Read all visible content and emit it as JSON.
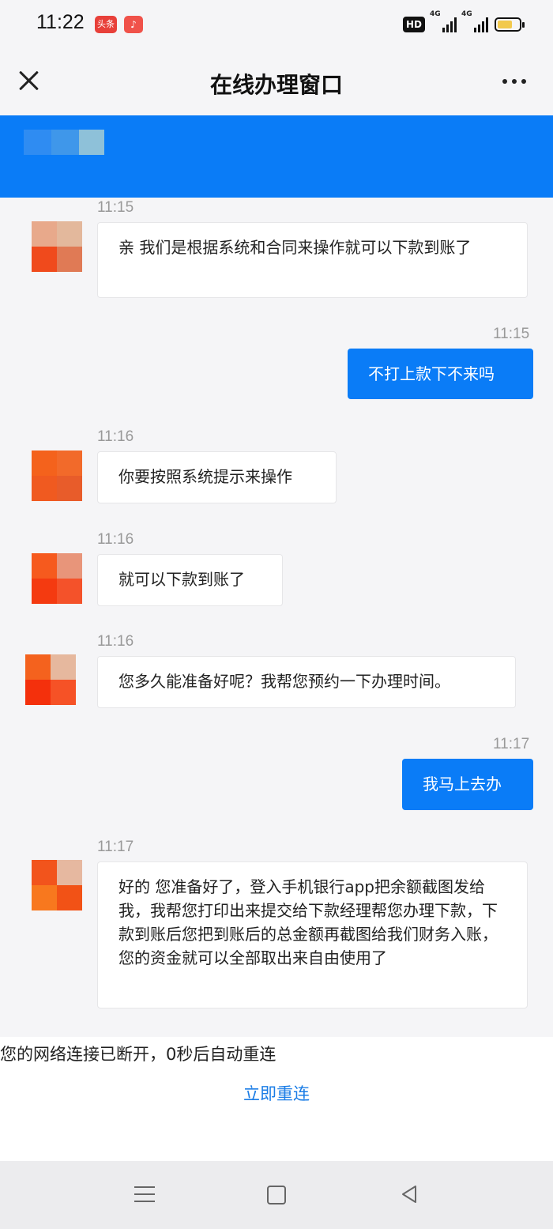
{
  "status_bar": {
    "time": "11:22",
    "app_badge_toutiao": "头条",
    "app_badge_music": "♪",
    "hd": "HD",
    "signal_1": "4G",
    "signal_2": "4G"
  },
  "nav": {
    "title": "在线办理窗口"
  },
  "messages": [
    {
      "side": "in",
      "time": "11:15",
      "text": "亲 我们是根据系统和合同来操作就可以下款到账了"
    },
    {
      "side": "out",
      "time": "11:15",
      "text": "不打上款下不来吗"
    },
    {
      "side": "in",
      "time": "11:16",
      "text": "你要按照系统提示来操作"
    },
    {
      "side": "in",
      "time": "11:16",
      "text": "就可以下款到账了"
    },
    {
      "side": "in",
      "time": "11:16",
      "text": "您多久能准备好呢？我帮您预约一下办理时间。"
    },
    {
      "side": "out",
      "time": "11:17",
      "text": "我马上去办"
    },
    {
      "side": "in",
      "time": "11:17",
      "text": "好的 您准备好了，登入手机银行app把余额截图发给我，我帮您打印出来提交给下款经理帮您办理下款，下款到账后您把到账后的总金额再截图给我们财务入账，您的资金就可以全部取出来自由使用了"
    }
  ],
  "disconnect": {
    "message": "您的网络连接已断开，0秒后自动重连",
    "reconnect_label": "立即重连"
  },
  "colors": {
    "accent": "#0a7cf7",
    "link": "#1b7de6",
    "background": "#f5f5f7"
  }
}
